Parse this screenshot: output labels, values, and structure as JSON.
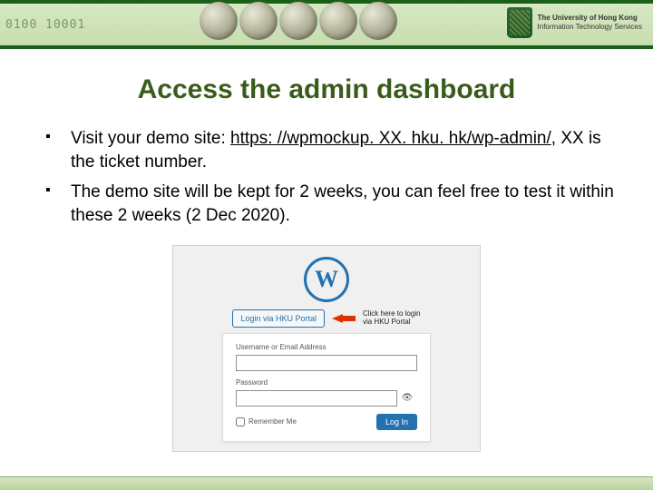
{
  "banner": {
    "binary_decor": "0100    10001",
    "uni_line1": "The University of Hong Kong",
    "uni_line2": "Information Technology Services"
  },
  "title": "Access the admin dashboard",
  "bullets": [
    {
      "lead": "Visit your demo site: ",
      "link": "https: //wpmockup. XX. hku. hk/wp-admin/",
      "tail": ", XX is the ticket number."
    },
    {
      "text": "The demo site will be kept for 2 weeks, you can feel free to test it within these 2 weeks (2 Dec 2020)."
    }
  ],
  "login": {
    "wp_glyph": "W",
    "portal_button": "Login via HKU Portal",
    "arrow_caption_l1": "Click here to login",
    "arrow_caption_l2": "via HKU Portal",
    "username_label": "Username or Email Address",
    "password_label": "Password",
    "remember_label": "Remember Me",
    "login_button": "Log In"
  }
}
